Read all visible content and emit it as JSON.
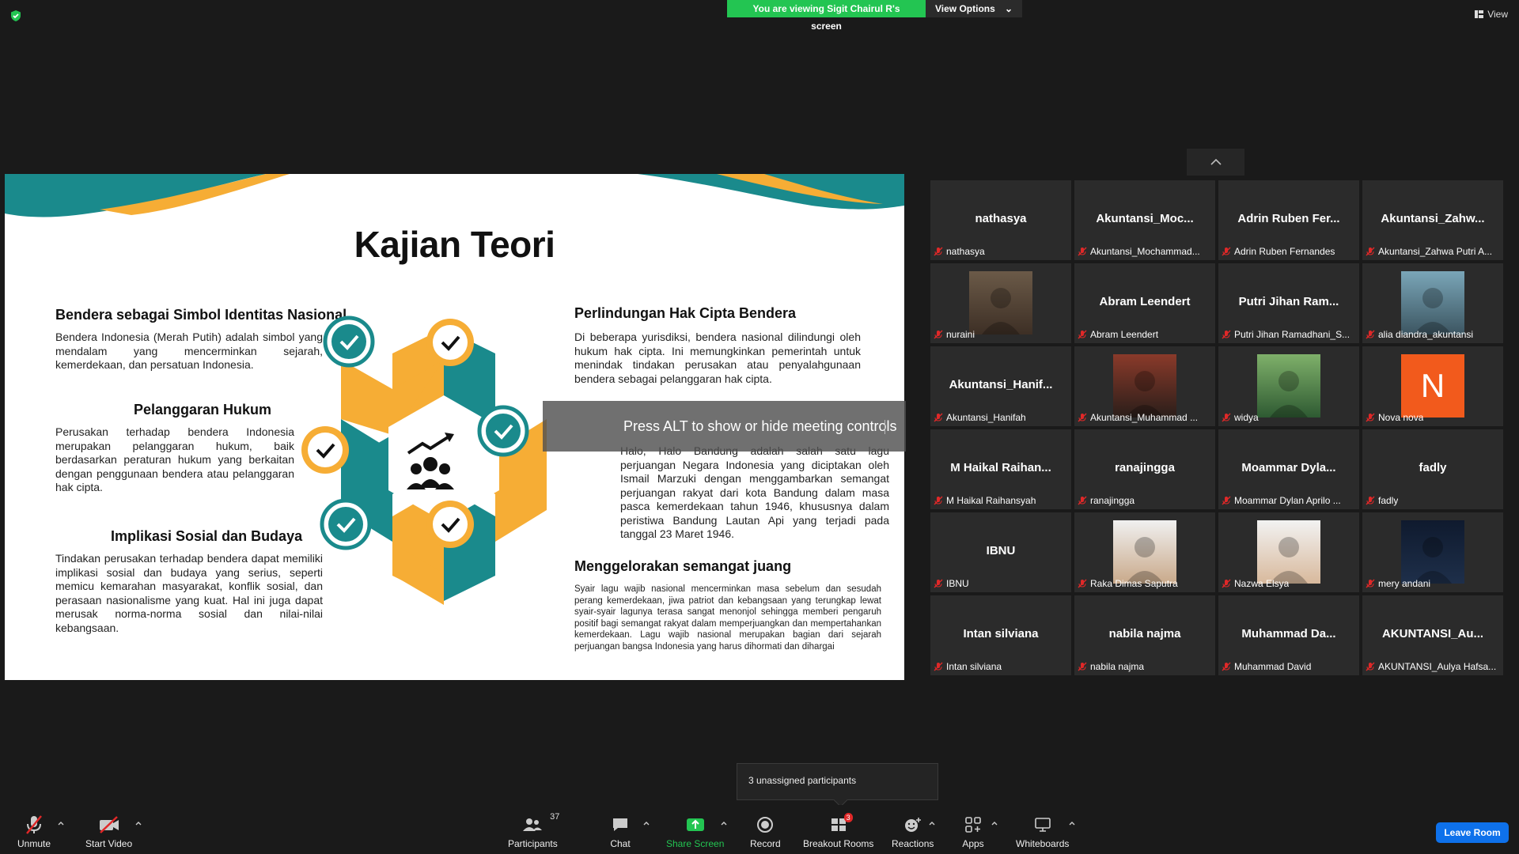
{
  "top": {
    "viewing_banner": "You are viewing Sigit Chairul R's screen",
    "view_options": "View Options",
    "view_label": "View"
  },
  "slide": {
    "title": "Kajian Teori",
    "sections": {
      "s1_heading": "Bendera sebagai Simbol Identitas Nasional",
      "s1_text": "Bendera Indonesia (Merah Putih) adalah simbol yang mendalam yang mencerminkan sejarah, kemerdekaan, dan persatuan Indonesia.",
      "s2_heading": "Pelanggaran Hukum",
      "s2_text": "Perusakan terhadap bendera Indonesia merupakan pelanggaran hukum, baik berdasarkan peraturan hukum yang berkaitan dengan penggunaan bendera atau pelanggaran hak cipta.",
      "s3_heading": "Implikasi Sosial dan Budaya",
      "s3_text": "Tindakan perusakan terhadap bendera dapat memiliki implikasi sosial dan budaya yang serius, seperti memicu kemarahan masyarakat, konflik sosial, dan perasaan nasionalisme yang kuat. Hal ini juga dapat merusak norma-norma sosial dan nilai-nilai kebangsaan.",
      "s4_heading": "Perlindungan Hak Cipta Bendera",
      "s4_text": "Di beberapa yurisdiksi, bendera nasional dilindungi oleh hukum hak cipta. Ini memungkinkan pemerintah untuk menindak tindakan perusakan atau penyalahgunaan bendera sebagai pelanggaran hak cipta.",
      "s5_text": "Halo, Halo Bandung adalah salah satu lagu perjuangan Negara Indonesia yang diciptakan oleh Ismail Marzuki dengan menggambarkan semangat perjuangan rakyat dari kota Bandung dalam masa pasca kemerdekaan tahun 1946, khususnya dalam peristiwa Bandung Lautan Api yang terjadi pada tanggal 23 Maret 1946.",
      "s6_heading": "Menggelorakan semangat juang",
      "s6_text": "Syair lagu wajib nasional mencerminkan masa sebelum dan sesudah perang kemerdekaan, jiwa patriot dan kebangsaan yang terungkap lewat syair-syair lagunya terasa sangat menonjol sehingga memberi pengaruh positif bagi semangat rakyat dalam memperjuangkan dan mempertahankan kemerdekaan. Lagu wajib nasional merupakan bagian dari sejarah perjuangan bangsa Indonesia yang harus dihormati dan dihargai"
    },
    "colors": {
      "teal": "#1a8a8c",
      "orange": "#f6ad35"
    }
  },
  "overlay": {
    "alt_tip": "Press ALT to show or hide meeting controls"
  },
  "gallery": [
    {
      "big": "nathasya",
      "name": "nathasya",
      "type": "text"
    },
    {
      "big": "Akuntansi_Moc...",
      "name": "Akuntansi_Mochammad...",
      "type": "text"
    },
    {
      "big": "Adrin Ruben Fer...",
      "name": "Adrin Ruben Fernandes",
      "type": "text"
    },
    {
      "big": "Akuntansi_Zahw...",
      "name": "Akuntansi_Zahwa Putri A...",
      "type": "text"
    },
    {
      "big": "",
      "name": "nuraini",
      "type": "photo"
    },
    {
      "big": "Abram Leendert",
      "name": "Abram Leendert",
      "type": "text"
    },
    {
      "big": "Putri Jihan Ram...",
      "name": "Putri Jihan Ramadhani_S...",
      "type": "text"
    },
    {
      "big": "",
      "name": "alia diandra_akuntansi",
      "type": "photo"
    },
    {
      "big": "Akuntansi_Hanif...",
      "name": "Akuntansi_Hanifah",
      "type": "text"
    },
    {
      "big": "",
      "name": "Akuntansi_Muhammad ...",
      "type": "photo"
    },
    {
      "big": "",
      "name": "widya",
      "type": "photo"
    },
    {
      "big": "N",
      "name": "Nova nova",
      "type": "letter"
    },
    {
      "big": "M Haikal Raihan...",
      "name": "M Haikal Raihansyah",
      "type": "text"
    },
    {
      "big": "ranajingga",
      "name": "ranajingga",
      "type": "text"
    },
    {
      "big": "Moammar Dyla...",
      "name": "Moammar Dylan Aprilo ...",
      "type": "text"
    },
    {
      "big": "fadly",
      "name": "fadly",
      "type": "text"
    },
    {
      "big": "IBNU",
      "name": "IBNU",
      "type": "text"
    },
    {
      "big": "",
      "name": "Raka Dimas Saputra",
      "type": "photo"
    },
    {
      "big": "",
      "name": "Nazwa Elsya",
      "type": "photo"
    },
    {
      "big": "",
      "name": "mery andani",
      "type": "photo"
    },
    {
      "big": "Intan silviana",
      "name": "Intan silviana",
      "type": "text"
    },
    {
      "big": "nabila najma",
      "name": "nabila najma",
      "type": "text"
    },
    {
      "big": "Muhammad Da...",
      "name": "Muhammad David",
      "type": "text"
    },
    {
      "big": "AKUNTANSI_Au...",
      "name": "AKUNTANSI_Aulya Hafsa...",
      "type": "text"
    }
  ],
  "popup": {
    "unassigned": "3 unassigned participants"
  },
  "toolbar": {
    "unmute": "Unmute",
    "start_video": "Start Video",
    "participants": "Participants",
    "participants_count": "37",
    "chat": "Chat",
    "share_screen": "Share Screen",
    "record": "Record",
    "breakout_rooms": "Breakout Rooms",
    "breakout_badge": "3",
    "reactions": "Reactions",
    "apps": "Apps",
    "whiteboards": "Whiteboards",
    "leave_room": "Leave Room"
  }
}
